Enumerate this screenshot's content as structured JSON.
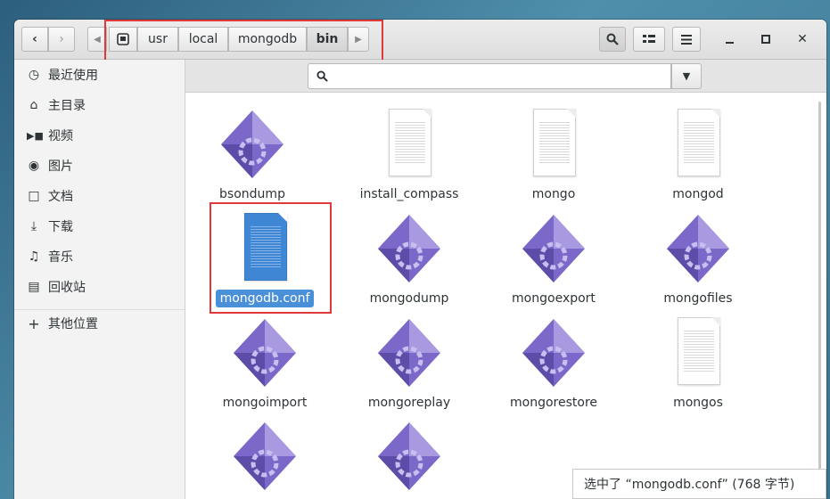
{
  "breadcrumb": [
    "usr",
    "local",
    "mongodb",
    "bin"
  ],
  "sidebar": {
    "items": [
      {
        "label": "最近使用",
        "icon": "clock-icon"
      },
      {
        "label": "主目录",
        "icon": "home-icon"
      },
      {
        "label": "视频",
        "icon": "video-icon"
      },
      {
        "label": "图片",
        "icon": "camera-icon"
      },
      {
        "label": "文档",
        "icon": "document-icon"
      },
      {
        "label": "下载",
        "icon": "download-icon"
      },
      {
        "label": "音乐",
        "icon": "music-icon"
      },
      {
        "label": "回收站",
        "icon": "trash-icon"
      }
    ],
    "other_locations": {
      "label": "其他位置",
      "icon": "plus-icon"
    }
  },
  "files": [
    {
      "name": "bsondump",
      "type": "executable"
    },
    {
      "name": "install_compass",
      "type": "text"
    },
    {
      "name": "mongo",
      "type": "text"
    },
    {
      "name": "mongod",
      "type": "text"
    },
    {
      "name": "mongodb.conf",
      "type": "text",
      "selected": true
    },
    {
      "name": "mongodump",
      "type": "executable"
    },
    {
      "name": "mongoexport",
      "type": "executable"
    },
    {
      "name": "mongofiles",
      "type": "executable"
    },
    {
      "name": "mongoimport",
      "type": "executable"
    },
    {
      "name": "mongoreplay",
      "type": "executable"
    },
    {
      "name": "mongorestore",
      "type": "executable"
    },
    {
      "name": "mongos",
      "type": "text"
    },
    {
      "name": "",
      "type": "executable"
    },
    {
      "name": "",
      "type": "executable"
    }
  ],
  "status": "选中了 “mongodb.conf” (768 字节)",
  "colors": {
    "selection": "#4a90d9",
    "highlight_box": "#e0393b",
    "exec_icon": "#7b68c9"
  }
}
